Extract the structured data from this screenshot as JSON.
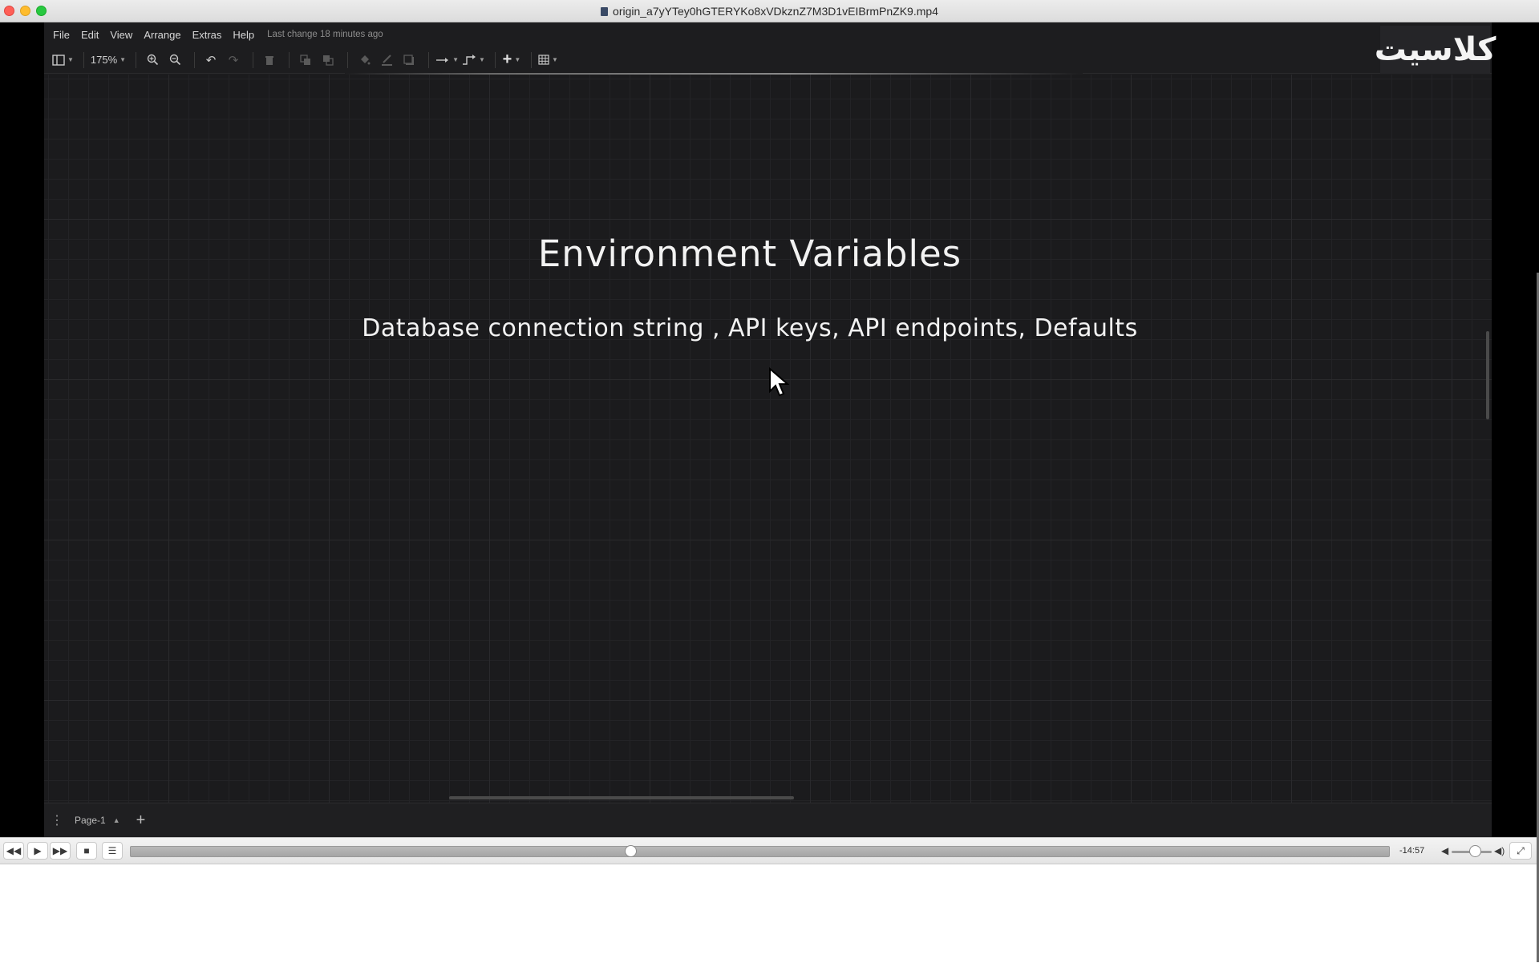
{
  "window": {
    "title": "origin_a7yYTey0hGTERYKo8xVDkznZ7M3D1vEIBrmPnZK9.mp4"
  },
  "app": {
    "menu": [
      "File",
      "Edit",
      "View",
      "Arrange",
      "Extras",
      "Help"
    ],
    "last_change": "Last change 18 minutes ago",
    "toolbar": {
      "zoom": "175%",
      "icons": [
        "sidebar-toggle-icon",
        "zoom-in-icon",
        "zoom-out-icon",
        "undo-icon",
        "redo-icon",
        "delete-icon",
        "to-front-icon",
        "to-back-icon",
        "fill-color-icon",
        "line-color-icon",
        "shadow-icon",
        "connection-icon",
        "waypoints-icon",
        "insert-icon",
        "table-icon"
      ]
    },
    "logo_text": "كلاسيت",
    "canvas": {
      "title": "Environment Variables",
      "subtitle": "Database connection string , API keys, API endpoints, Defaults"
    },
    "pages": {
      "current": "Page-1"
    }
  },
  "player": {
    "time_remaining": "-14:57",
    "progress": 0.398,
    "volume": 0.6
  }
}
